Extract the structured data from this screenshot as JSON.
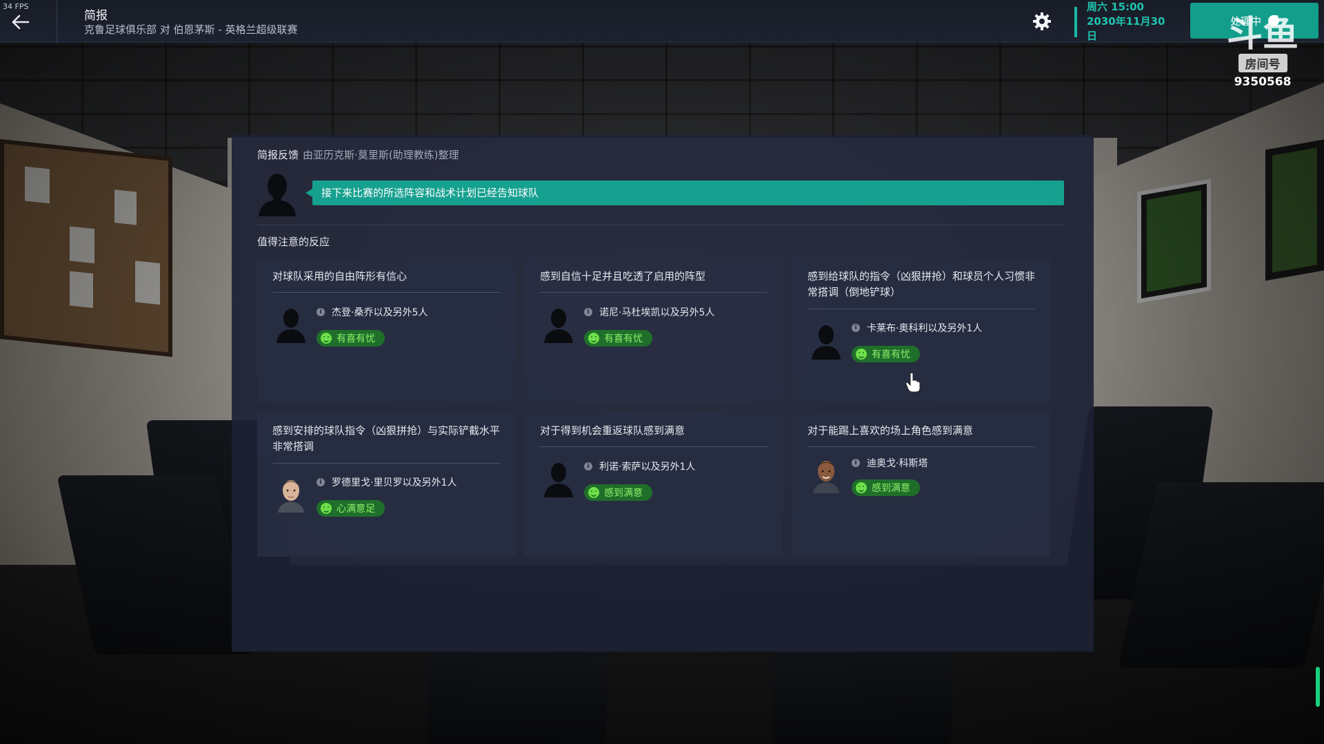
{
  "topbar": {
    "fps": "34 FPS",
    "title": "简报",
    "subtitle": "克鲁足球俱乐部 对 伯恩茅斯 - 英格兰超级联赛",
    "date_line1": "周六 15:00",
    "date_line2": "2030年11月30",
    "date_line3": "日",
    "process_label": "处理中",
    "accent_color": "#19b9a6"
  },
  "watermark": {
    "logo": "斗鱼",
    "label": "房间号",
    "number": "9350568"
  },
  "feedback": {
    "title": "简报反馈",
    "author": "由亚历克斯·莫里斯(助理教练)整理",
    "message": "接下来比赛的所选阵容和战术计划已经告知球队",
    "section_title": "值得注意的反应"
  },
  "cards": [
    {
      "title": "对球队采用的自由阵形有信心",
      "player": "杰登·桑乔以及另外5人",
      "badge": "有喜有忧",
      "avatar": "silhouette"
    },
    {
      "title": "感到自信十足并且吃透了启用的阵型",
      "player": "诺尼·马杜埃凯以及另外5人",
      "badge": "有喜有忧",
      "avatar": "silhouette"
    },
    {
      "title": "感到给球队的指令（凶狠拼抢）和球员个人习惯非常搭调（倒地铲球）",
      "player": "卡莱布·奥科利以及另外1人",
      "badge": "有喜有忧",
      "avatar": "silhouette"
    },
    {
      "title": "感到安排的球队指令（凶狠拼抢）与实际铲截水平非常搭调",
      "player": "罗德里戈·里贝罗以及另外1人",
      "badge": "心满意足",
      "avatar": "face-light"
    },
    {
      "title": "对于得到机会重返球队感到满意",
      "player": "利诺·索萨以及另外1人",
      "badge": "感到满意",
      "avatar": "silhouette"
    },
    {
      "title": "对于能踢上喜欢的场上角色感到满意",
      "player": "迪奥戈·科斯塔",
      "badge": "感到满意",
      "avatar": "face-dark"
    }
  ]
}
